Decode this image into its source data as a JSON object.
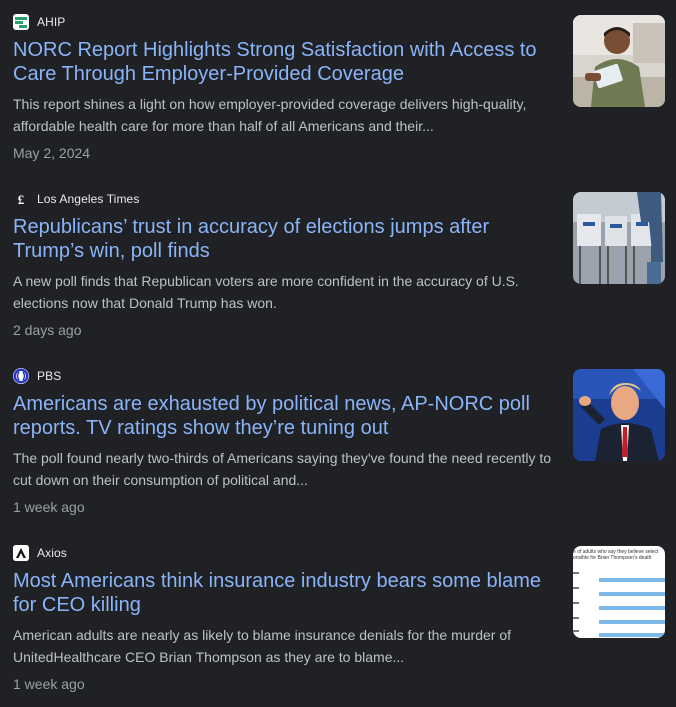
{
  "articles": [
    {
      "source": "AHIP",
      "favicon_icon": "ahip-logo-icon",
      "headline": "NORC Report Highlights Strong Satisfaction with Access to Care Through Employer-Provided Coverage",
      "snippet": "This report shines a light on how employer-provided coverage delivers high-quality, affordable health care for more than half of all Americans and their...",
      "date": "May 2, 2024",
      "thumbnail": "man-with-tablet-image"
    },
    {
      "source": "Los Angeles Times",
      "favicon_icon": "la-times-logo-icon",
      "headline": "Republicans’ trust in accuracy of elections jumps after Trump’s win, poll finds",
      "snippet": "A new poll finds that Republican voters are more confident in the accuracy of U.S. elections now that Donald Trump has won.",
      "date": "2 days ago",
      "thumbnail": "voting-booths-image"
    },
    {
      "source": "PBS",
      "favicon_icon": "pbs-logo-icon",
      "headline": "Americans are exhausted by political news, AP-NORC poll reports. TV ratings show they’re tuning out",
      "snippet": "The poll found nearly two-thirds of Americans saying they've found the need recently to cut down on their consumption of political and...",
      "date": "1 week ago",
      "thumbnail": "trump-pointing-image"
    },
    {
      "source": "Axios",
      "favicon_icon": "axios-logo-icon",
      "headline": "Most Americans think insurance industry bears some blame for CEO killing",
      "snippet": "American adults are nearly as likely to blame insurance denials for the murder of UnitedHealthcare CEO Brian Thompson as they are to blame...",
      "date": "1 week ago",
      "thumbnail": "poll-chart-image",
      "thumb_chart_title": "e of adults who say they believe select onsible for Brian Thompson's death"
    }
  ],
  "colors": {
    "background": "#202124",
    "headline": "#8ab4f8",
    "snippet": "#bdc1c6",
    "date": "#9aa0a6",
    "source": "#e8eaed"
  }
}
